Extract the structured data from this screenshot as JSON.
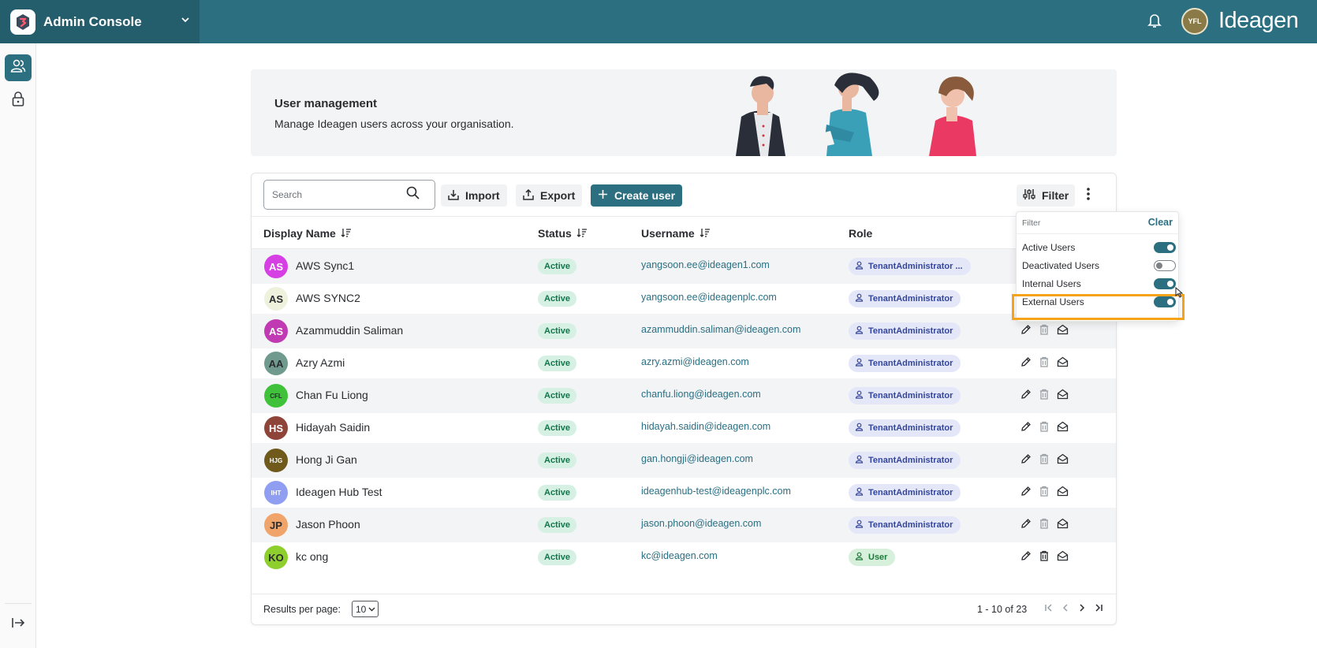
{
  "header": {
    "app_title": "Admin Console",
    "avatar_initials": "YFL",
    "brand": "Ideagen"
  },
  "banner": {
    "title": "User management",
    "subtitle": "Manage Ideagen users across your organisation."
  },
  "toolbar": {
    "search_placeholder": "Search",
    "import_label": "Import",
    "export_label": "Export",
    "create_label": "Create user",
    "filter_label": "Filter"
  },
  "columns": {
    "display_name": "Display Name",
    "status": "Status",
    "username": "Username",
    "role": "Role"
  },
  "users": [
    {
      "initials": "AS",
      "color": "#d63fe3",
      "name": "AWS Sync1",
      "status": "Active",
      "username": "yangsoon.ee@ideagen1.com",
      "role": "TenantAdministrator ..."
    },
    {
      "initials": "AS",
      "color": "#eef1dc",
      "name": "AWS SYNC2",
      "status": "Active",
      "username": "yangsoon.ee@ideagenplc.com",
      "role": "TenantAdministrator"
    },
    {
      "initials": "AS",
      "color": "#c03ab4",
      "name": "Azammuddin Saliman",
      "status": "Active",
      "username": "azammuddin.saliman@ideagen.com",
      "role": "TenantAdministrator"
    },
    {
      "initials": "AA",
      "color": "#6f9a8d",
      "name": "Azry Azmi",
      "status": "Active",
      "username": "azry.azmi@ideagen.com",
      "role": "TenantAdministrator"
    },
    {
      "initials": "CFL",
      "color": "#3fc23a",
      "name": "Chan Fu Liong",
      "status": "Active",
      "username": "chanfu.liong@ideagen.com",
      "role": "TenantAdministrator"
    },
    {
      "initials": "HS",
      "color": "#8e4438",
      "name": "Hidayah Saidin",
      "status": "Active",
      "username": "hidayah.saidin@ideagen.com",
      "role": "TenantAdministrator"
    },
    {
      "initials": "HJG",
      "color": "#6f5a1c",
      "name": "Hong Ji Gan",
      "status": "Active",
      "username": "gan.hongji@ideagen.com",
      "role": "TenantAdministrator"
    },
    {
      "initials": "IHT",
      "color": "#8f9ef0",
      "name": "Ideagen Hub Test",
      "status": "Active",
      "username": "ideagenhub-test@ideagenplc.com",
      "role": "TenantAdministrator"
    },
    {
      "initials": "JP",
      "color": "#f0a46a",
      "name": "Jason Phoon",
      "status": "Active",
      "username": "jason.phoon@ideagen.com",
      "role": "TenantAdministrator"
    },
    {
      "initials": "KO",
      "color": "#8fcf2d",
      "name": "kc ong",
      "status": "Active",
      "username": "kc@ideagen.com",
      "role": "User"
    }
  ],
  "pagination": {
    "per_page_label": "Results per page:",
    "per_page_value": "10",
    "range_text": "1 - 10 of 23"
  },
  "filter_panel": {
    "label": "Filter",
    "clear_label": "Clear",
    "items": [
      {
        "label": "Active Users",
        "on": true
      },
      {
        "label": "Deactivated Users",
        "on": false
      },
      {
        "label": "Internal Users",
        "on": true
      },
      {
        "label": "External Users",
        "on": true
      }
    ]
  },
  "colors": {
    "accent": "#2b6f80",
    "highlight": "#f5a31a",
    "status_bg": "#d6f0e4",
    "role_bg": "#e4e7f8"
  }
}
